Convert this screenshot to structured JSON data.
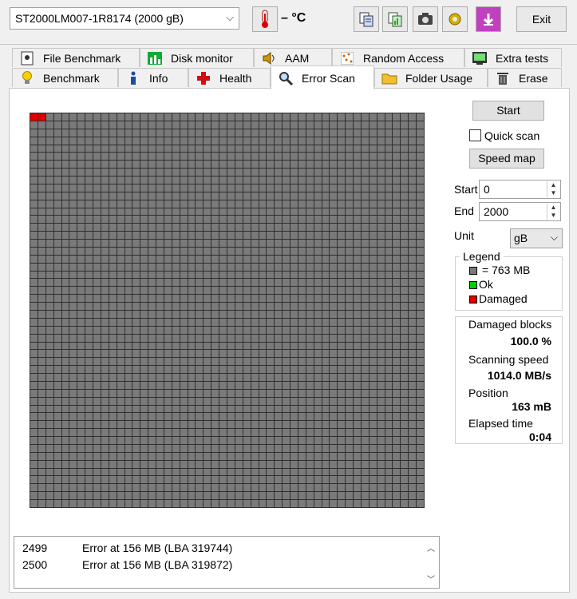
{
  "toolbar": {
    "drive": "ST2000LM007-1R8174 (2000 gB)",
    "temperature": "– °C",
    "exit_label": "Exit",
    "icons": [
      "thermometer-icon",
      "copy-text-icon",
      "copy-info-icon",
      "screenshot-icon",
      "options-icon",
      "save-icon"
    ]
  },
  "tabs_top": [
    {
      "label": "File Benchmark",
      "icon": "file-benchmark-icon"
    },
    {
      "label": "Disk monitor",
      "icon": "disk-monitor-icon"
    },
    {
      "label": "AAM",
      "icon": "speaker-icon"
    },
    {
      "label": "Random Access",
      "icon": "random-access-icon"
    },
    {
      "label": "Extra tests",
      "icon": "extra-tests-icon"
    }
  ],
  "tabs_bottom": [
    {
      "label": "Benchmark",
      "icon": "lightbulb-icon"
    },
    {
      "label": "Info",
      "icon": "info-icon"
    },
    {
      "label": "Health",
      "icon": "health-cross-icon"
    },
    {
      "label": "Error Scan",
      "icon": "magnifier-icon"
    },
    {
      "label": "Folder Usage",
      "icon": "folder-icon"
    },
    {
      "label": "Erase",
      "icon": "trash-icon"
    }
  ],
  "active_tab": "Error Scan",
  "controls": {
    "start_button": "Start",
    "quick_scan_label": "Quick scan",
    "quick_scan_checked": false,
    "speed_map_button": "Speed map",
    "start_label": "Start",
    "start_value": "0",
    "end_label": "End",
    "end_value": "2000",
    "unit_label": "Unit",
    "unit_value": "gB"
  },
  "legend": {
    "title": "Legend",
    "block": "= 763 MB",
    "ok": "Ok",
    "damaged": "Damaged",
    "colors": {
      "block": "#7a7a7a",
      "ok": "#00d000",
      "damaged": "#e00000"
    }
  },
  "stats": {
    "damaged_blocks_label": "Damaged blocks",
    "damaged_blocks_value": "100.0 %",
    "scanning_speed_label": "Scanning speed",
    "scanning_speed_value": "1014.0 MB/s",
    "position_label": "Position",
    "position_value": "163 mB",
    "elapsed_label": "Elapsed time",
    "elapsed_value": "0:04"
  },
  "grid": {
    "rows": 50,
    "cols": 50,
    "damaged_count": 2
  },
  "log": [
    {
      "num": "2499",
      "msg": "Error at 156 MB (LBA 319744)"
    },
    {
      "num": "2500",
      "msg": "Error at 156 MB (LBA 319872)"
    }
  ]
}
